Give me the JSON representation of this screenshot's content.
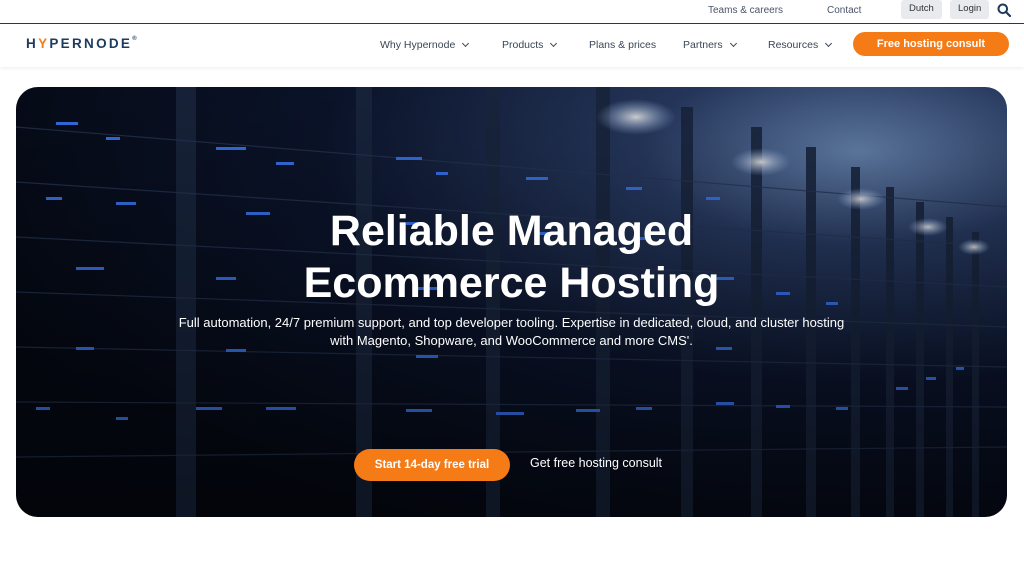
{
  "topbar": {
    "teams_careers": "Teams & careers",
    "contact": "Contact",
    "language": "Dutch",
    "login": "Login",
    "search_icon": "search-icon"
  },
  "nav": {
    "logo": {
      "prefix": "H",
      "accent": "Y",
      "rest": "PERNODE",
      "mark": "®"
    },
    "items": [
      {
        "label": "Why Hypernode",
        "has_dropdown": true
      },
      {
        "label": "Products",
        "has_dropdown": true
      },
      {
        "label": "Plans & prices",
        "has_dropdown": false
      },
      {
        "label": "Partners",
        "has_dropdown": true
      },
      {
        "label": "Resources",
        "has_dropdown": true
      }
    ],
    "cta": "Free hosting consult"
  },
  "hero": {
    "title_line1": "Reliable Managed",
    "title_line2": "Ecommerce Hosting",
    "subtitle_line1": "Full automation, 24/7 premium support, and top developer tooling. Expertise in dedicated, cloud, and cluster hosting",
    "subtitle_line2": "with Magento, Shopware, and WooCommerce and more CMS'.",
    "primary_cta": "Start 14-day free trial",
    "secondary_cta": "Get free hosting consult"
  },
  "colors": {
    "accent": "#f47b16",
    "brand_navy": "#1d3a5f"
  }
}
